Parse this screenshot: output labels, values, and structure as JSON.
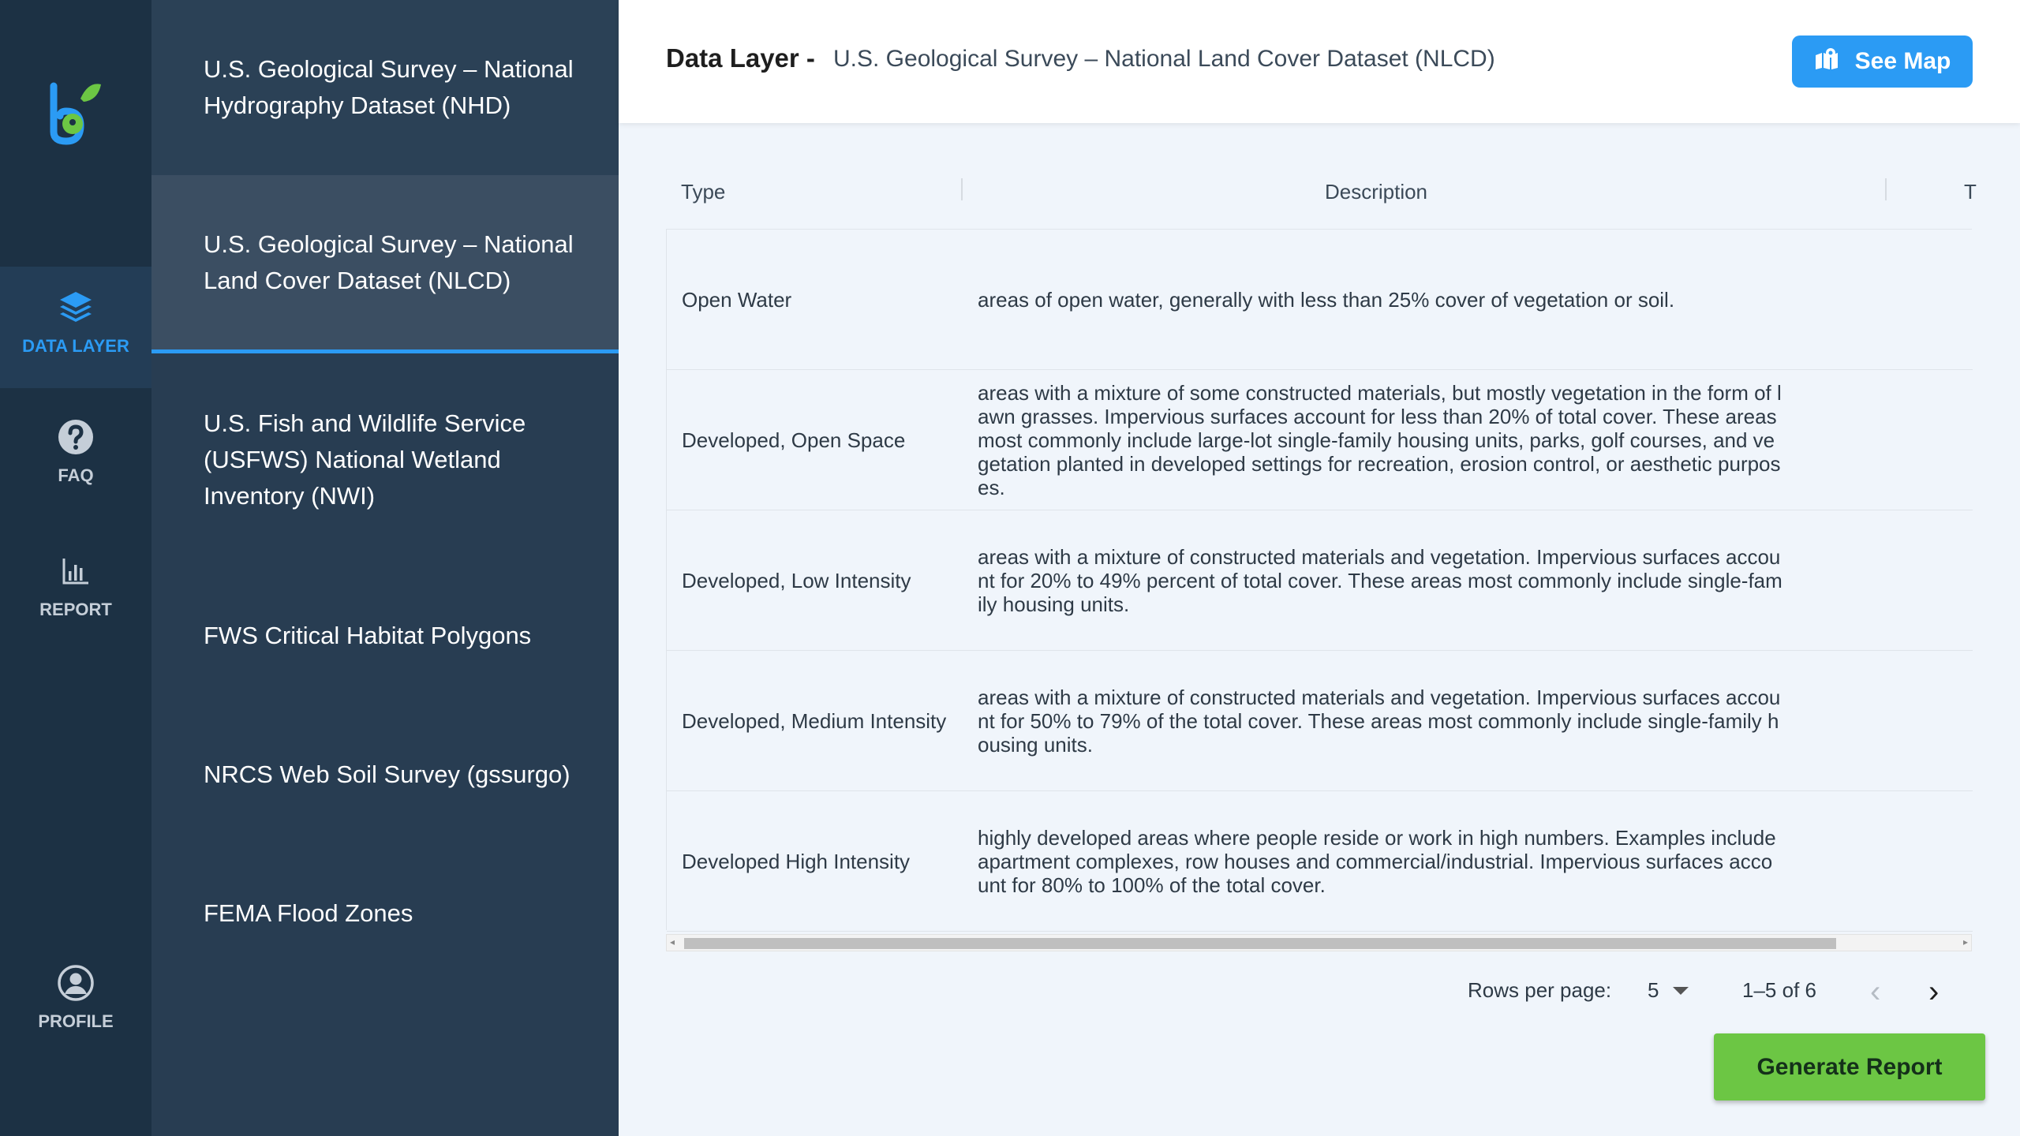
{
  "nav": {
    "items": [
      {
        "label": "DATA LAYER",
        "icon": "layers-icon",
        "active": true
      },
      {
        "label": "FAQ",
        "icon": "help-circle-icon",
        "active": false
      },
      {
        "label": "REPORT",
        "icon": "bar-chart-icon",
        "active": false
      },
      {
        "label": "PROFILE",
        "icon": "user-circle-icon",
        "active": false
      }
    ]
  },
  "sources": [
    {
      "label": "U.S. Geological Survey – National Hydrography Dataset (NHD)"
    },
    {
      "label": "U.S. Geological Survey – National Land Cover Dataset (NLCD)",
      "active": true
    },
    {
      "label": "U.S. Fish and Wildlife Service (USFWS) National Wetland Inventory (NWI)"
    },
    {
      "label": "FWS Critical Habitat Polygons"
    },
    {
      "label": "NRCS Web Soil Survey (gssurgo)"
    },
    {
      "label": "FEMA Flood Zones"
    }
  ],
  "header": {
    "title": "Data Layer -",
    "subtitle": "U.S. Geological Survey – National Land Cover Dataset (NLCD)",
    "see_map_label": "See Map"
  },
  "table": {
    "columns": [
      "Type",
      "Description",
      "T"
    ],
    "rows": [
      {
        "type": "Open Water",
        "description": "areas of open water, generally with less than 25% cover of vegetation or soil."
      },
      {
        "type": "Developed, Open Space",
        "description": "areas with a mixture of some constructed materials, but mostly vegetation in the form of lawn grasses. Impervious surfaces account for less than 20% of total cover. These areas most commonly include large-lot single-family housing units, parks, golf courses, and vegetation planted in developed settings for recreation, erosion control, or aesthetic purposes."
      },
      {
        "type": "Developed, Low Intensity",
        "description": "areas with a mixture of constructed materials and vegetation. Impervious surfaces account for 20% to 49% percent of total cover. These areas most commonly include single-family housing units."
      },
      {
        "type": "Developed, Medium Intensity",
        "description": "areas with a mixture of constructed materials and vegetation. Impervious surfaces account for 50% to 79% of the total cover. These areas most commonly include single-family housing units."
      },
      {
        "type": "Developed High Intensity",
        "description": "highly developed areas where people reside or work in high numbers. Examples include apartment complexes, row houses and commercial/industrial. Impervious surfaces account for 80% to 100% of the total cover."
      }
    ]
  },
  "pagination": {
    "rows_per_page_label": "Rows per page:",
    "rows_per_page": "5",
    "range": "1–5 of 6",
    "prev": "‹",
    "next": "›"
  },
  "generate_label": "Generate Report",
  "colors": {
    "accent": "#2b9bf4",
    "rail_bg": "#1c3144",
    "list_bg": "#283d52",
    "generate_bg": "#6cc644"
  }
}
